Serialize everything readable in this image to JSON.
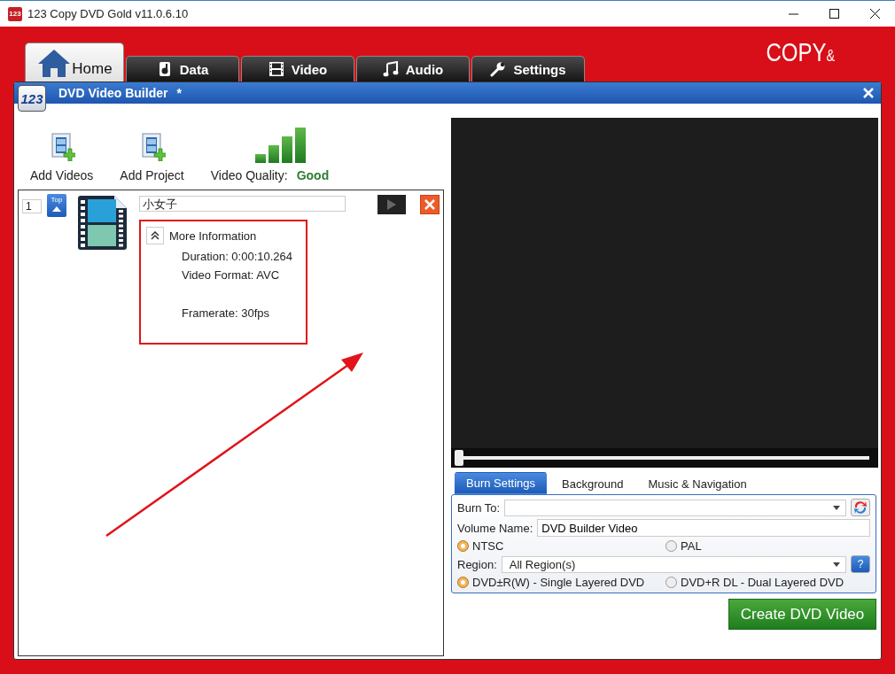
{
  "window": {
    "app_icon": "123",
    "title": "123 Copy DVD Gold v11.0.6.10"
  },
  "tabs": [
    {
      "label": "Home",
      "selected": true
    },
    {
      "label": "Data",
      "selected": false
    },
    {
      "label": "Video",
      "selected": false
    },
    {
      "label": "Audio",
      "selected": false
    },
    {
      "label": "Settings",
      "selected": false
    }
  ],
  "brand": {
    "text": "COPY",
    "mark": "&"
  },
  "dialog": {
    "logo": "123",
    "title": "DVD Video Builder",
    "modified_mark": "*"
  },
  "toolbar": [
    {
      "label": "Add Videos"
    },
    {
      "label": "Add Project"
    }
  ],
  "quality": {
    "label": "Video Quality:",
    "value": "Good"
  },
  "videos": [
    {
      "number": "1",
      "top_label": "Top",
      "name": "小女子",
      "info_title": "More Information",
      "expanded": true,
      "info": [
        {
          "text": "Duration: 0:00:10.264",
          "spaced": false
        },
        {
          "text": "Video Format: AVC",
          "spaced": false
        },
        {
          "text": "Framerate: 30fps",
          "spaced": true
        }
      ]
    }
  ],
  "player": {
    "level": 0
  },
  "settings_tabs": [
    {
      "label": "Burn Settings",
      "selected": true
    },
    {
      "label": "Background",
      "selected": false
    },
    {
      "label": "Music & Navigation",
      "selected": false
    }
  ],
  "burn": {
    "burn_to_label": "Burn To:",
    "volume_label": "Volume Name:",
    "volume_value": "DVD Builder Video",
    "standards": [
      {
        "label": "NTSC",
        "selected": true
      },
      {
        "label": "PAL",
        "selected": false
      }
    ],
    "region_label": "Region:",
    "region_value": "All Region(s)",
    "help": "?",
    "disc_types": [
      {
        "label": "DVD±R(W) - Single Layered DVD",
        "selected": true
      },
      {
        "label": "DVD+R DL - Dual Layered DVD",
        "selected": false
      }
    ]
  },
  "create_button": "Create DVD Video"
}
